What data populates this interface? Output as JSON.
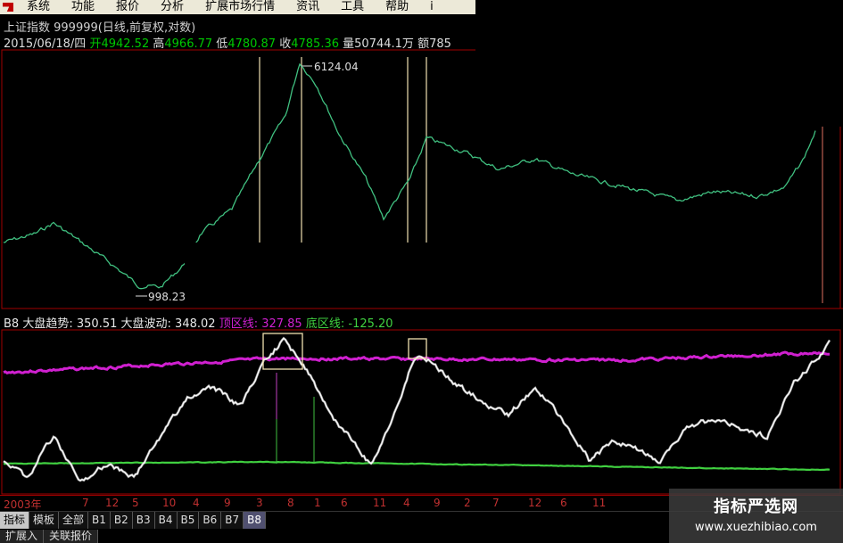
{
  "menu": {
    "items": [
      "系统",
      "功能",
      "报价",
      "分析",
      "扩展市场行情",
      "资讯",
      "工具",
      "帮助",
      "i"
    ]
  },
  "header": {
    "title": "上证指数 999999(日线,前复权,对数)",
    "date": "2015/06/18/四",
    "open_label": "开",
    "open": "4942.52",
    "high_label": "高",
    "high": "4966.77",
    "low_label": "低",
    "low": "4780.87",
    "close_label": "收",
    "close": "4785.36",
    "volume_label": "量",
    "volume": "50744.1万",
    "amount_label": "额",
    "amount": "785"
  },
  "price_chart": {
    "peak_label": "6124.04",
    "trough_label": "998.23"
  },
  "indicator": {
    "name": "B8",
    "trend_label": "大盘趋势:",
    "trend_value": "350.51",
    "wave_label": "大盘波动:",
    "wave_value": "348.02",
    "top_label": "顶区线:",
    "top_value": "327.85",
    "bottom_label": "底区线:",
    "bottom_value": "-125.20"
  },
  "date_axis": [
    "2003年",
    "7",
    "12",
    "5",
    "10",
    "4",
    "9",
    "3",
    "8",
    "1",
    "6",
    "11",
    "4",
    "9",
    "2",
    "7",
    "12",
    "6",
    "11"
  ],
  "tabs": [
    "指标",
    "模板",
    "全部",
    "B1",
    "B2",
    "B3",
    "B4",
    "B5",
    "B6",
    "B7",
    "B8"
  ],
  "tabs2": [
    "扩展入",
    "关联报价"
  ],
  "watermark": {
    "name": "指标严选网",
    "url": "www.xuezhibiao.com"
  },
  "colors": {
    "price_line": "#40c080",
    "top_line": "#d020d0",
    "bottom_line": "#40d040",
    "wave_line": "#ffffff",
    "axis_red": "#a00000"
  }
}
